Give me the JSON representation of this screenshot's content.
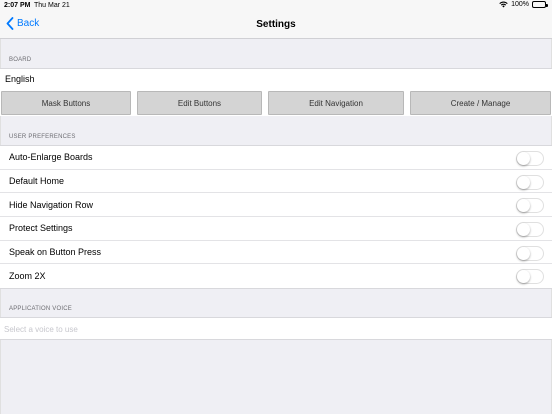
{
  "status_bar": {
    "time": "2:07 PM",
    "date": "Thu Mar 21",
    "battery_pct": "100%",
    "icons": [
      "wifi-icon",
      "battery-icon"
    ]
  },
  "nav": {
    "back_label": "Back",
    "title": "Settings"
  },
  "board": {
    "header": "BOARD",
    "value": "English",
    "buttons": [
      "Mask Buttons",
      "Edit Buttons",
      "Edit Navigation",
      "Create / Manage"
    ]
  },
  "preferences": {
    "header": "USER PREFERENCES",
    "items": [
      {
        "label": "Auto-Enlarge Boards",
        "on": false
      },
      {
        "label": "Default Home",
        "on": false
      },
      {
        "label": "Hide Navigation Row",
        "on": false
      },
      {
        "label": "Protect Settings",
        "on": false
      },
      {
        "label": "Speak on Button Press",
        "on": false
      },
      {
        "label": "Zoom 2X",
        "on": false
      }
    ]
  },
  "voice": {
    "header": "APPLICATION VOICE",
    "value": "",
    "placeholder": "Select a voice to use"
  },
  "colors": {
    "accent": "#007aff",
    "background": "#efeff4",
    "button_gray": "#d4d4d4"
  }
}
